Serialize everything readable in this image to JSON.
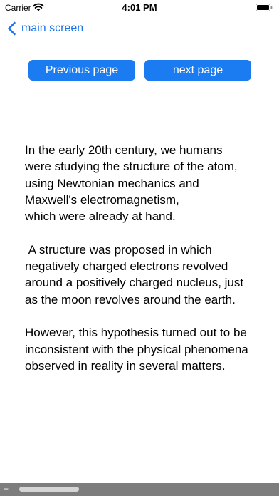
{
  "status_bar": {
    "carrier": "Carrier",
    "time": "4:01 PM"
  },
  "nav": {
    "back_label": "main screen"
  },
  "buttons": {
    "previous": "Previous page",
    "next": "next page"
  },
  "content": {
    "text": "In the early 20th century, we humans were studying the structure of the atom,\nusing Newtonian mechanics and Maxwell's electromagnetism,\nwhich were already at hand.\n\n A structure was proposed in which negatively charged electrons revolved around a positively charged nucleus, just as the moon revolves around the earth.\n\nHowever, this hypothesis turned out to be inconsistent with the physical phenomena observed in reality in several matters."
  },
  "colors": {
    "accent": "#1a7cf0",
    "link": "#1a73e8",
    "scrollbar": "#7d7d7d"
  },
  "icons": {
    "wifi": "wifi-icon",
    "battery": "battery-icon",
    "back": "chevron-left-icon",
    "add": "plus-icon"
  }
}
